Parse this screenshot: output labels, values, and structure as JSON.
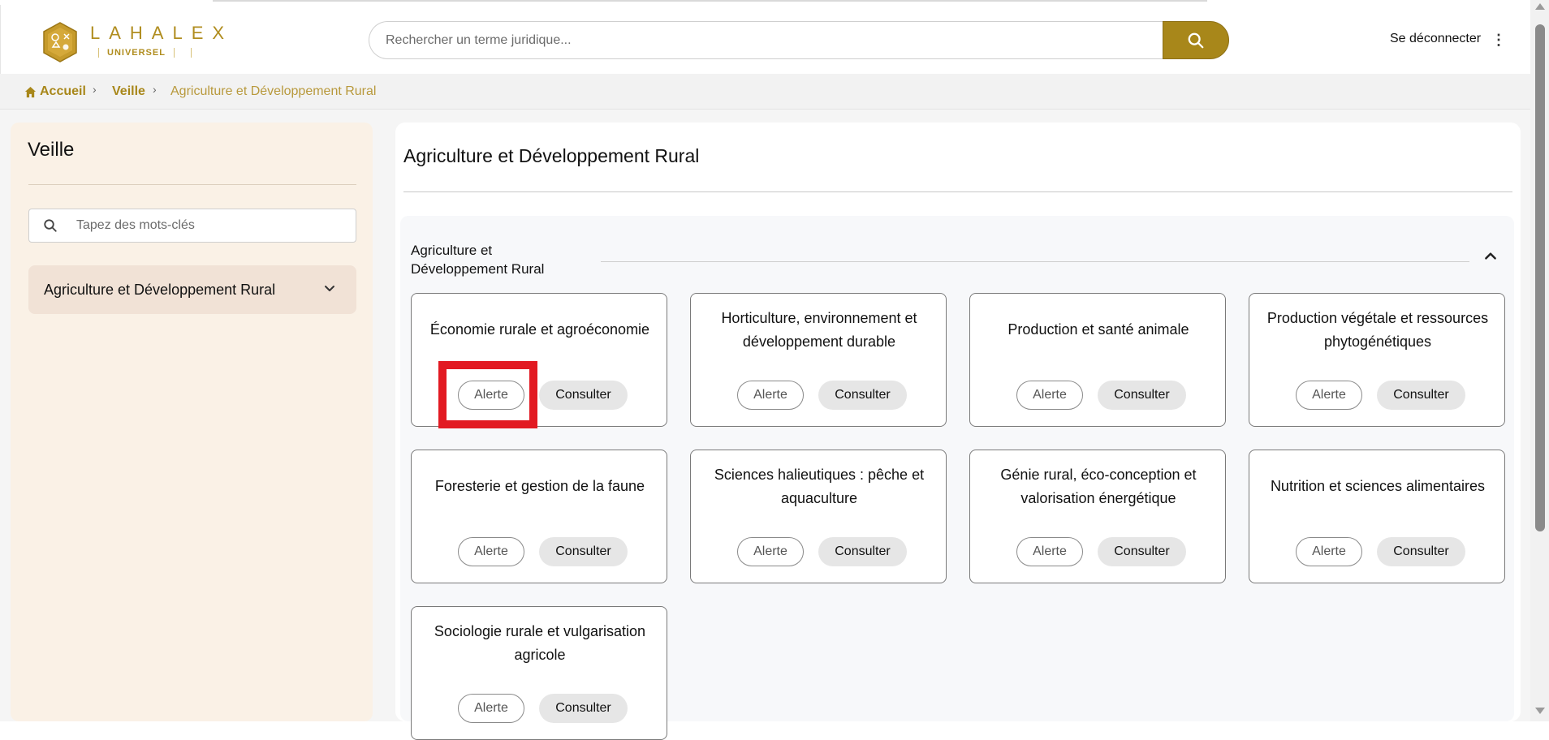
{
  "header": {
    "logo_title": "LAHALEX",
    "logo_subtitle": "UNIVERSEL",
    "search_placeholder": "Rechercher un terme juridique...",
    "logout_label": "Se déconnecter",
    "menu_icon": "kebab-menu-icon"
  },
  "breadcrumb": {
    "home": "Accueil",
    "veille": "Veille",
    "current": "Agriculture et Développement Rural"
  },
  "sidebar": {
    "title": "Veille",
    "search_placeholder": "Tapez des mots-clés",
    "items": [
      {
        "label": "Agriculture et Développement Rural"
      }
    ]
  },
  "main": {
    "title": "Agriculture et Développement Rural",
    "section": {
      "title": "Agriculture et Développement Rural",
      "cards": [
        {
          "title": "Économie rurale et agroéconomie",
          "alerte": "Alerte",
          "consulter": "Consulter"
        },
        {
          "title": "Horticulture, environnement et développement durable",
          "alerte": "Alerte",
          "consulter": "Consulter"
        },
        {
          "title": "Production et santé animale",
          "alerte": "Alerte",
          "consulter": "Consulter"
        },
        {
          "title": "Production végétale et ressources phytogénétiques",
          "alerte": "Alerte",
          "consulter": "Consulter"
        },
        {
          "title": "Foresterie et gestion de la faune",
          "alerte": "Alerte",
          "consulter": "Consulter"
        },
        {
          "title": "Sciences halieutiques : pêche et aquaculture",
          "alerte": "Alerte",
          "consulter": "Consulter"
        },
        {
          "title": "Génie rural, éco-conception et valorisation énergétique",
          "alerte": "Alerte",
          "consulter": "Consulter"
        },
        {
          "title": "Nutrition et sciences alimentaires",
          "alerte": "Alerte",
          "consulter": "Consulter"
        },
        {
          "title": "Sociologie rurale et vulgarisation agricole",
          "alerte": "Alerte",
          "consulter": "Consulter"
        }
      ]
    }
  },
  "colors": {
    "brand_gold": "#a8871a",
    "highlight_red": "#e21a22",
    "sidebar_bg": "#faf1e6"
  }
}
